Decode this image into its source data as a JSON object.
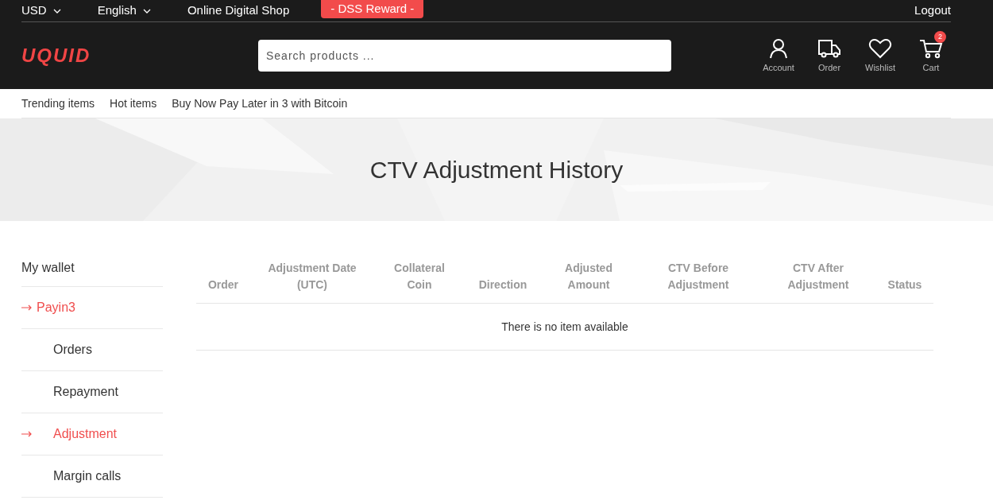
{
  "topbar": {
    "currency": "USD",
    "language": "English",
    "shop_link": "Online Digital Shop",
    "reward_button": "- DSS Reward -",
    "logout": "Logout"
  },
  "header": {
    "logo": "UQUID",
    "search": {
      "placeholder": "Search products ..."
    },
    "actions": [
      {
        "kind": "account",
        "label": "Account"
      },
      {
        "kind": "order",
        "label": "Order"
      },
      {
        "kind": "wishlist",
        "label": "Wishlist"
      },
      {
        "kind": "cart",
        "label": "Cart",
        "badge": "2"
      }
    ]
  },
  "nav": [
    "Trending items",
    "Hot items",
    "Buy Now Pay Later in 3 with Bitcoin"
  ],
  "hero": {
    "kind": "picture",
    "title": "CTV Adjustment History"
  },
  "sidebar": {
    "title": "My wallet",
    "items": [
      {
        "label": "Payin3",
        "selected": true,
        "children": [
          {
            "label": "Orders",
            "selected": false
          },
          {
            "label": "Repayment",
            "selected": false
          },
          {
            "label": "Adjustment",
            "selected": true
          },
          {
            "label": "Margin calls",
            "selected": false
          }
        ]
      }
    ]
  },
  "table": {
    "columns": [
      [
        "Order"
      ],
      [
        "Adjustment Date",
        "(UTC)"
      ],
      [
        "Collateral",
        "Coin"
      ],
      [
        "Direction"
      ],
      [
        "Adjusted",
        "Amount"
      ],
      [
        "CTV Before",
        "Adjustment"
      ],
      [
        "CTV After",
        "Adjustment"
      ],
      [
        "Status"
      ]
    ],
    "empty_message": "There is no item available"
  }
}
